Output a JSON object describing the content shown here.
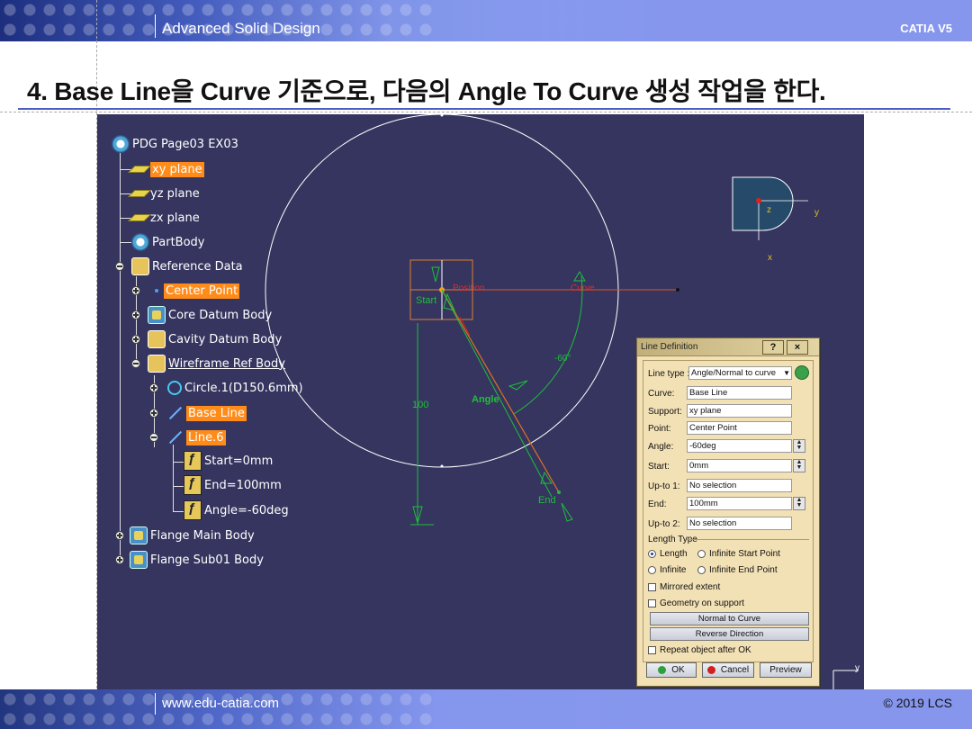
{
  "header": {
    "title": "Advanced Solid Design",
    "brand": "CATIA V5"
  },
  "heading": "4. Base Line을 Curve 기준으로, 다음의 Angle To Curve 생성 작업을 한다.",
  "tree": {
    "root": "PDG Page03 EX03",
    "items": [
      {
        "label": "xy plane"
      },
      {
        "label": "yz plane"
      },
      {
        "label": "zx plane"
      },
      {
        "label": "PartBody"
      },
      {
        "label": "Reference Data"
      },
      {
        "label": "Center Point"
      },
      {
        "label": "Core Datum Body"
      },
      {
        "label": "Cavity Datum Body"
      },
      {
        "label": "Wireframe Ref Body"
      },
      {
        "label": "Circle.1(D150.6mm)"
      },
      {
        "label": "Base Line"
      },
      {
        "label": "Line.6"
      },
      {
        "label": "Start=0mm"
      },
      {
        "label": "End=100mm"
      },
      {
        "label": "Angle=-60deg"
      },
      {
        "label": "Flange Main Body"
      },
      {
        "label": "Flange Sub01 Body"
      }
    ]
  },
  "canvas": {
    "start_label": "Start",
    "end_label": "End",
    "angle_label": "Angle",
    "length_label": "100",
    "angle_value_label": "-60°",
    "position_label": "Position",
    "curve_label": "Curve",
    "compass": {
      "z": "z",
      "y": "y",
      "x": "x"
    },
    "axis_y": "y"
  },
  "dialog": {
    "title": "Line Definition",
    "help_btn": "?",
    "close_btn": "×",
    "line_type_label": "Line type :",
    "line_type_value": "Angle/Normal to curve",
    "fields": [
      {
        "label": "Curve:",
        "value": "Base Line"
      },
      {
        "label": "Support:",
        "value": "xy plane"
      },
      {
        "label": "Point:",
        "value": "Center Point"
      },
      {
        "label": "Angle:",
        "value": "-60deg"
      },
      {
        "label": "Start:",
        "value": "0mm"
      },
      {
        "label": "Up-to 1:",
        "value": "No selection"
      },
      {
        "label": "End:",
        "value": "100mm"
      },
      {
        "label": "Up-to 2:",
        "value": "No selection"
      }
    ],
    "length_type_label": "Length Type",
    "radio_length": "Length",
    "radio_infinite_start": "Infinite Start Point",
    "radio_infinite": "Infinite",
    "radio_infinite_end": "Infinite End Point",
    "chk_mirrored": "Mirrored extent",
    "chk_geometry": "Geometry on support",
    "btn_normal": "Normal to Curve",
    "btn_reverse": "Reverse Direction",
    "chk_repeat": "Repeat object after OK",
    "btn_ok": "OK",
    "btn_cancel": "Cancel",
    "btn_preview": "Preview"
  },
  "footer": {
    "url": "www.edu-catia.com",
    "copyright": "© 2019 LCS"
  }
}
